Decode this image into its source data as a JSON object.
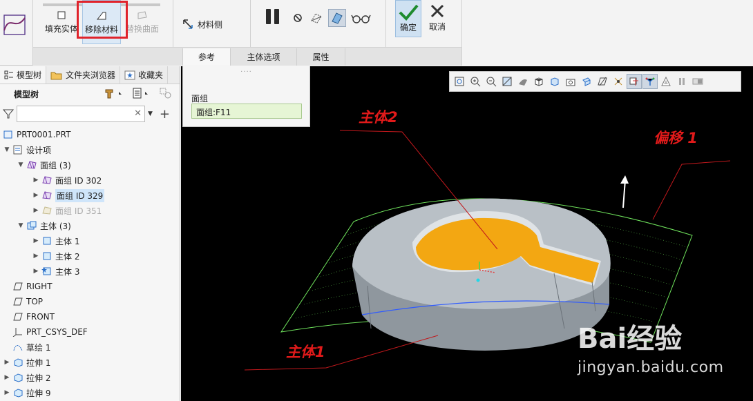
{
  "ribbon": {
    "fill_solid": "填充实体",
    "remove_material": "移除材料",
    "replace_surface": "替换曲面",
    "material_side": "材料侧",
    "ok": "确定",
    "cancel": "取消",
    "tabs": [
      "参考",
      "主体选项",
      "属性"
    ]
  },
  "left_panel": {
    "tabs": [
      "模型树",
      "文件夹浏览器",
      "收藏夹"
    ],
    "header": "模型树",
    "filter_placeholder": "",
    "tree": [
      {
        "label": "PRT0001.PRT"
      },
      {
        "label": "设计项"
      },
      {
        "label": "面组 (3)"
      },
      {
        "label": "面组 ID 302"
      },
      {
        "label": "面组 ID 329"
      },
      {
        "label": "面组 ID 351"
      },
      {
        "label": "主体 (3)"
      },
      {
        "label": "主体 1"
      },
      {
        "label": "主体 2"
      },
      {
        "label": "主体 3"
      },
      {
        "label": "RIGHT"
      },
      {
        "label": "TOP"
      },
      {
        "label": "FRONT"
      },
      {
        "label": "PRT_CSYS_DEF"
      },
      {
        "label": "草绘 1"
      },
      {
        "label": "拉伸 1"
      },
      {
        "label": "拉伸 2"
      },
      {
        "label": "拉伸 9"
      }
    ]
  },
  "ref_panel": {
    "dots": "....",
    "label": "面组",
    "value": "面组:F11"
  },
  "annotations": {
    "body2": "主体2",
    "offset1": "偏移 1",
    "body1": "主体1"
  },
  "watermark": {
    "brand": "Bai经验",
    "url": "jingyan.baidu.com"
  },
  "colors": {
    "highlight_red": "#e0232b",
    "annotation_red": "#e11a1a",
    "selected_surface": "#f3a712",
    "quilt_green": "#6fe35c",
    "viewport_bg": "#000000"
  }
}
